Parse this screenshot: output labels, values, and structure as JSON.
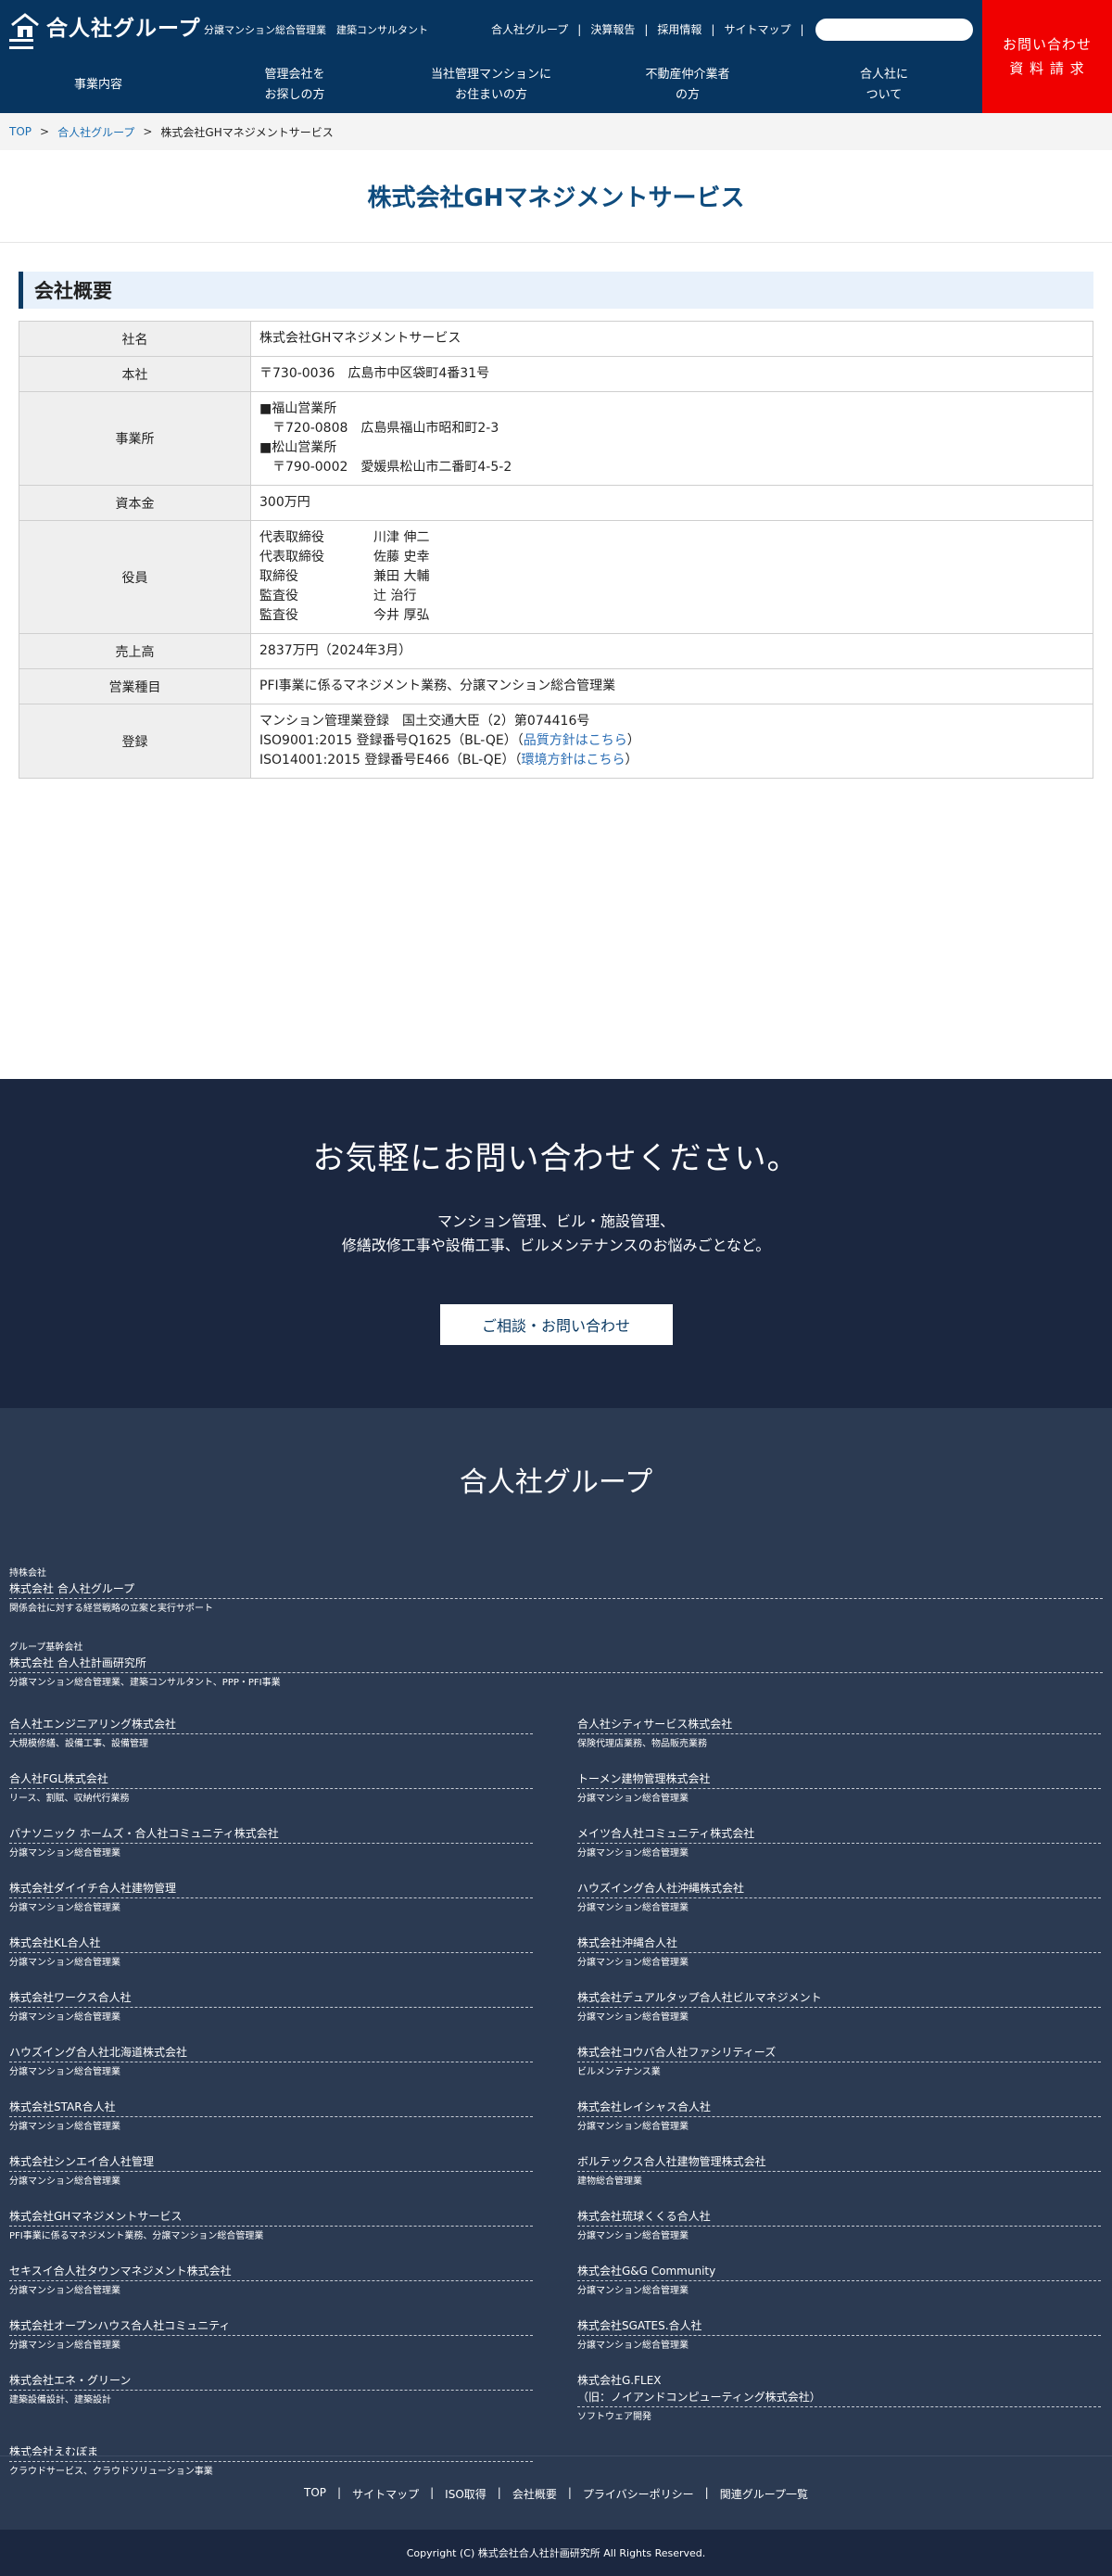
{
  "header": {
    "logo": "合人社グループ",
    "tagline": "分譲マンション総合管理業　建築コンサルタント",
    "util_links": [
      "合人社グループ",
      "決算報告",
      "採用情報",
      "サイトマップ"
    ],
    "search_placeholder": "",
    "cta_lines": [
      "お問い合わせ",
      "資 料 請 求"
    ],
    "nav": [
      "事業内容",
      "管理会社を\nお探しの方",
      "当社管理マンションに\nお住まいの方",
      "不動産仲介業者\nの方",
      "合人社に\nついて"
    ],
    "colors": {
      "navy": "#073560",
      "cta": "#f00000"
    }
  },
  "breadcrumb": [
    "TOP",
    "合人社グループ",
    "株式会社GHマネジメントサービス"
  ],
  "page_title": "株式会社GHマネジメントサービス",
  "section_title": "会社概要",
  "profile": {
    "name": {
      "label": "社名",
      "value": "株式会社GHマネジメントサービス"
    },
    "hq": {
      "label": "本社",
      "value": "〒730-0036　広島市中区袋町4番31号"
    },
    "offices": {
      "label": "事業所",
      "lines": [
        "■福山営業所",
        "　〒720-0808　広島県福山市昭和町2-3",
        "■松山営業所",
        "　〒790-0002　愛媛県松山市二番町4-5-2"
      ]
    },
    "capital": {
      "label": "資本金",
      "value": "300万円"
    },
    "officers": {
      "label": "役員",
      "rows": [
        {
          "role": "代表取締役",
          "name": "川津 伸二"
        },
        {
          "role": "代表取締役",
          "name": "佐藤 史幸"
        },
        {
          "role": "取締役",
          "name": "兼田 大輔"
        },
        {
          "role": "監査役",
          "name": "辻 治行"
        },
        {
          "role": "監査役",
          "name": "今井 厚弘"
        }
      ]
    },
    "sales": {
      "label": "売上高",
      "value": "2837万円（2024年3月）"
    },
    "business": {
      "label": "営業種目",
      "value": "PFI事業に係るマネジメント業務、分譲マンション総合管理業"
    },
    "registration": {
      "label": "登録",
      "line1": "マンション管理業登録　国土交通大臣（2）第074416号",
      "line2_pre": "ISO9001:2015 登録番号Q1625（BL-QE）（",
      "line2_link": "品質方針はこちら",
      "line2_post": "）",
      "line3_pre": "ISO14001:2015 登録番号E466（BL-QE）（",
      "line3_link": "環境方針はこちら",
      "line3_post": "）"
    }
  },
  "contact": {
    "heading": "お気軽にお問い合わせください。",
    "line1": "マンション管理、ビル・施設管理、",
    "line2": "修繕改修工事や設備工事、ビルメンテナンスのお悩みごとなど。",
    "button": "ご相談・お問い合わせ"
  },
  "footer": {
    "heading": "合人社グループ",
    "holding": {
      "cap": "持株会社",
      "name": "株式会社 合人社グループ",
      "desc": "関係会社に対する経営戦略の立案と実行サポート"
    },
    "core": {
      "cap": "グループ基幹会社",
      "name": "株式会社 合人社計画研究所",
      "desc": "分譲マンション総合管理業、建築コンサルタント、PPP・PFI事業"
    },
    "companies": [
      {
        "name": "合人社エンジニアリング株式会社",
        "desc": "大規模修繕、設備工事、設備管理"
      },
      {
        "name": "合人社シティサービス株式会社",
        "desc": "保険代理店業務、物品販売業務"
      },
      {
        "name": "合人社FGL株式会社",
        "desc": "リース、割賦、収納代行業務"
      },
      {
        "name": "トーメン建物管理株式会社",
        "desc": "分譲マンション総合管理業"
      },
      {
        "name": "パナソニック ホームズ・合人社コミュニティ株式会社",
        "desc": "分譲マンション総合管理業"
      },
      {
        "name": "メイツ合人社コミュニティ株式会社",
        "desc": "分譲マンション総合管理業"
      },
      {
        "name": "株式会社ダイイチ合人社建物管理",
        "desc": "分譲マンション総合管理業"
      },
      {
        "name": "ハウズイング合人社沖縄株式会社",
        "desc": "分譲マンション総合管理業"
      },
      {
        "name": "株式会社KL合人社",
        "desc": "分譲マンション総合管理業"
      },
      {
        "name": "株式会社沖縄合人社",
        "desc": "分譲マンション総合管理業"
      },
      {
        "name": "株式会社ワークス合人社",
        "desc": "分譲マンション総合管理業"
      },
      {
        "name": "株式会社デュアルタップ合人社ビルマネジメント",
        "desc": "分譲マンション総合管理業"
      },
      {
        "name": "ハウズイング合人社北海道株式会社",
        "desc": "分譲マンション総合管理業"
      },
      {
        "name": "株式会社コウバ合人社ファシリティーズ",
        "desc": "ビルメンテナンス業"
      },
      {
        "name": "株式会社STAR合人社",
        "desc": "分譲マンション総合管理業"
      },
      {
        "name": "株式会社レイシャス合人社",
        "desc": "分譲マンション総合管理業"
      },
      {
        "name": "株式会社シンエイ合人社管理",
        "desc": "分譲マンション総合管理業"
      },
      {
        "name": "ボルテックス合人社建物管理株式会社",
        "desc": "建物総合管理業"
      },
      {
        "name": "株式会社GHマネジメントサービス",
        "desc": "PFI事業に係るマネジメント業務、分譲マンション総合管理業"
      },
      {
        "name": "株式会社琉球くくる合人社",
        "desc": "分譲マンション総合管理業"
      },
      {
        "name": "セキスイ合人社タウンマネジメント株式会社",
        "desc": "分譲マンション総合管理業"
      },
      {
        "name": "株式会社G&G Community",
        "desc": "分譲マンション総合管理業"
      },
      {
        "name": "株式会社オープンハウス合人社コミュニティ",
        "desc": "分譲マンション総合管理業"
      },
      {
        "name": "株式会社SGATES.合人社",
        "desc": "分譲マンション総合管理業"
      },
      {
        "name": "株式会社エネ・グリーン",
        "desc": "建築設備設計、建築設計"
      },
      {
        "name": "株式会社G.FLEX\n（旧：ノイアンドコンピューティング株式会社）",
        "desc": "ソフトウェア開発"
      },
      {
        "name": "株式会社えむぼま",
        "desc": "クラウドサービス、クラウドソリューション事業"
      }
    ],
    "links": [
      "TOP",
      "サイトマップ",
      "ISO取得",
      "会社概要",
      "プライバシーポリシー",
      "関連グループ一覧"
    ],
    "copyright": "Copyright (C) 株式会社合人社計画研究所 All Rights Reserved."
  }
}
